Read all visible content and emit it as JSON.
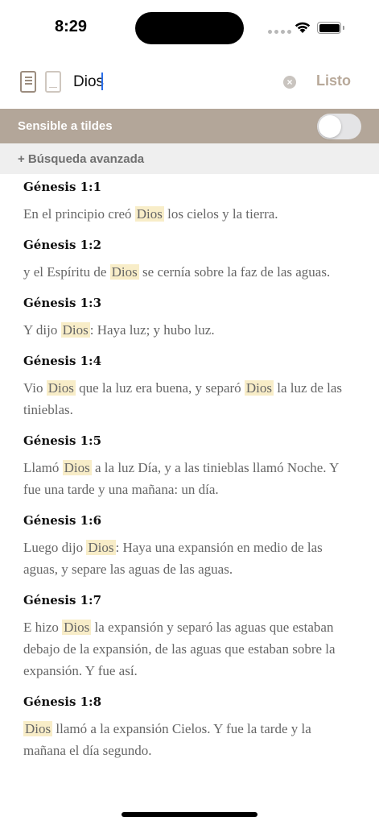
{
  "status_bar": {
    "time": "8:29"
  },
  "search": {
    "query": "Dios",
    "done_label": "Listo",
    "clear_symbol": "×"
  },
  "accent_sensitive": {
    "label": "Sensible a tildes",
    "enabled": false
  },
  "advanced_search": {
    "label": "+ Búsqueda avanzada"
  },
  "highlight_term": "Dios",
  "colors": {
    "accent_bar": "#b3a699",
    "highlight": "#f8edc8",
    "done": "#b8a99a"
  },
  "results": [
    {
      "ref": "Génesis 1:1",
      "parts": [
        "En el principio creó ",
        "Dios",
        " los cielos y la tierra."
      ]
    },
    {
      "ref": "Génesis 1:2",
      "parts": [
        "y el Espíritu de ",
        "Dios",
        " se cernía sobre la faz de las aguas."
      ]
    },
    {
      "ref": "Génesis 1:3",
      "parts": [
        "Y dijo ",
        "Dios",
        ": Haya luz; y hubo luz."
      ]
    },
    {
      "ref": "Génesis 1:4",
      "parts": [
        "Vio ",
        "Dios",
        " que la luz era buena, y separó ",
        "Dios",
        " la luz de las tinieblas."
      ]
    },
    {
      "ref": "Génesis 1:5",
      "parts": [
        "Llamó ",
        "Dios",
        " a la luz Día, y a las tinieblas llamó Noche. Y fue una tarde y una mañana: un día."
      ]
    },
    {
      "ref": "Génesis 1:6",
      "parts": [
        "Luego dijo ",
        "Dios",
        ": Haya una expansión en medio de las aguas, y separe las aguas de las aguas."
      ]
    },
    {
      "ref": "Génesis 1:7",
      "parts": [
        "E hizo ",
        "Dios",
        " la expansión y separó las aguas que estaban debajo de la expansión, de las aguas que estaban sobre la expansión. Y fue así."
      ]
    },
    {
      "ref": "Génesis 1:8",
      "parts": [
        "Dios",
        " llamó a la expansión Cielos. Y fue la tarde y la mañana el día segundo."
      ]
    }
  ]
}
